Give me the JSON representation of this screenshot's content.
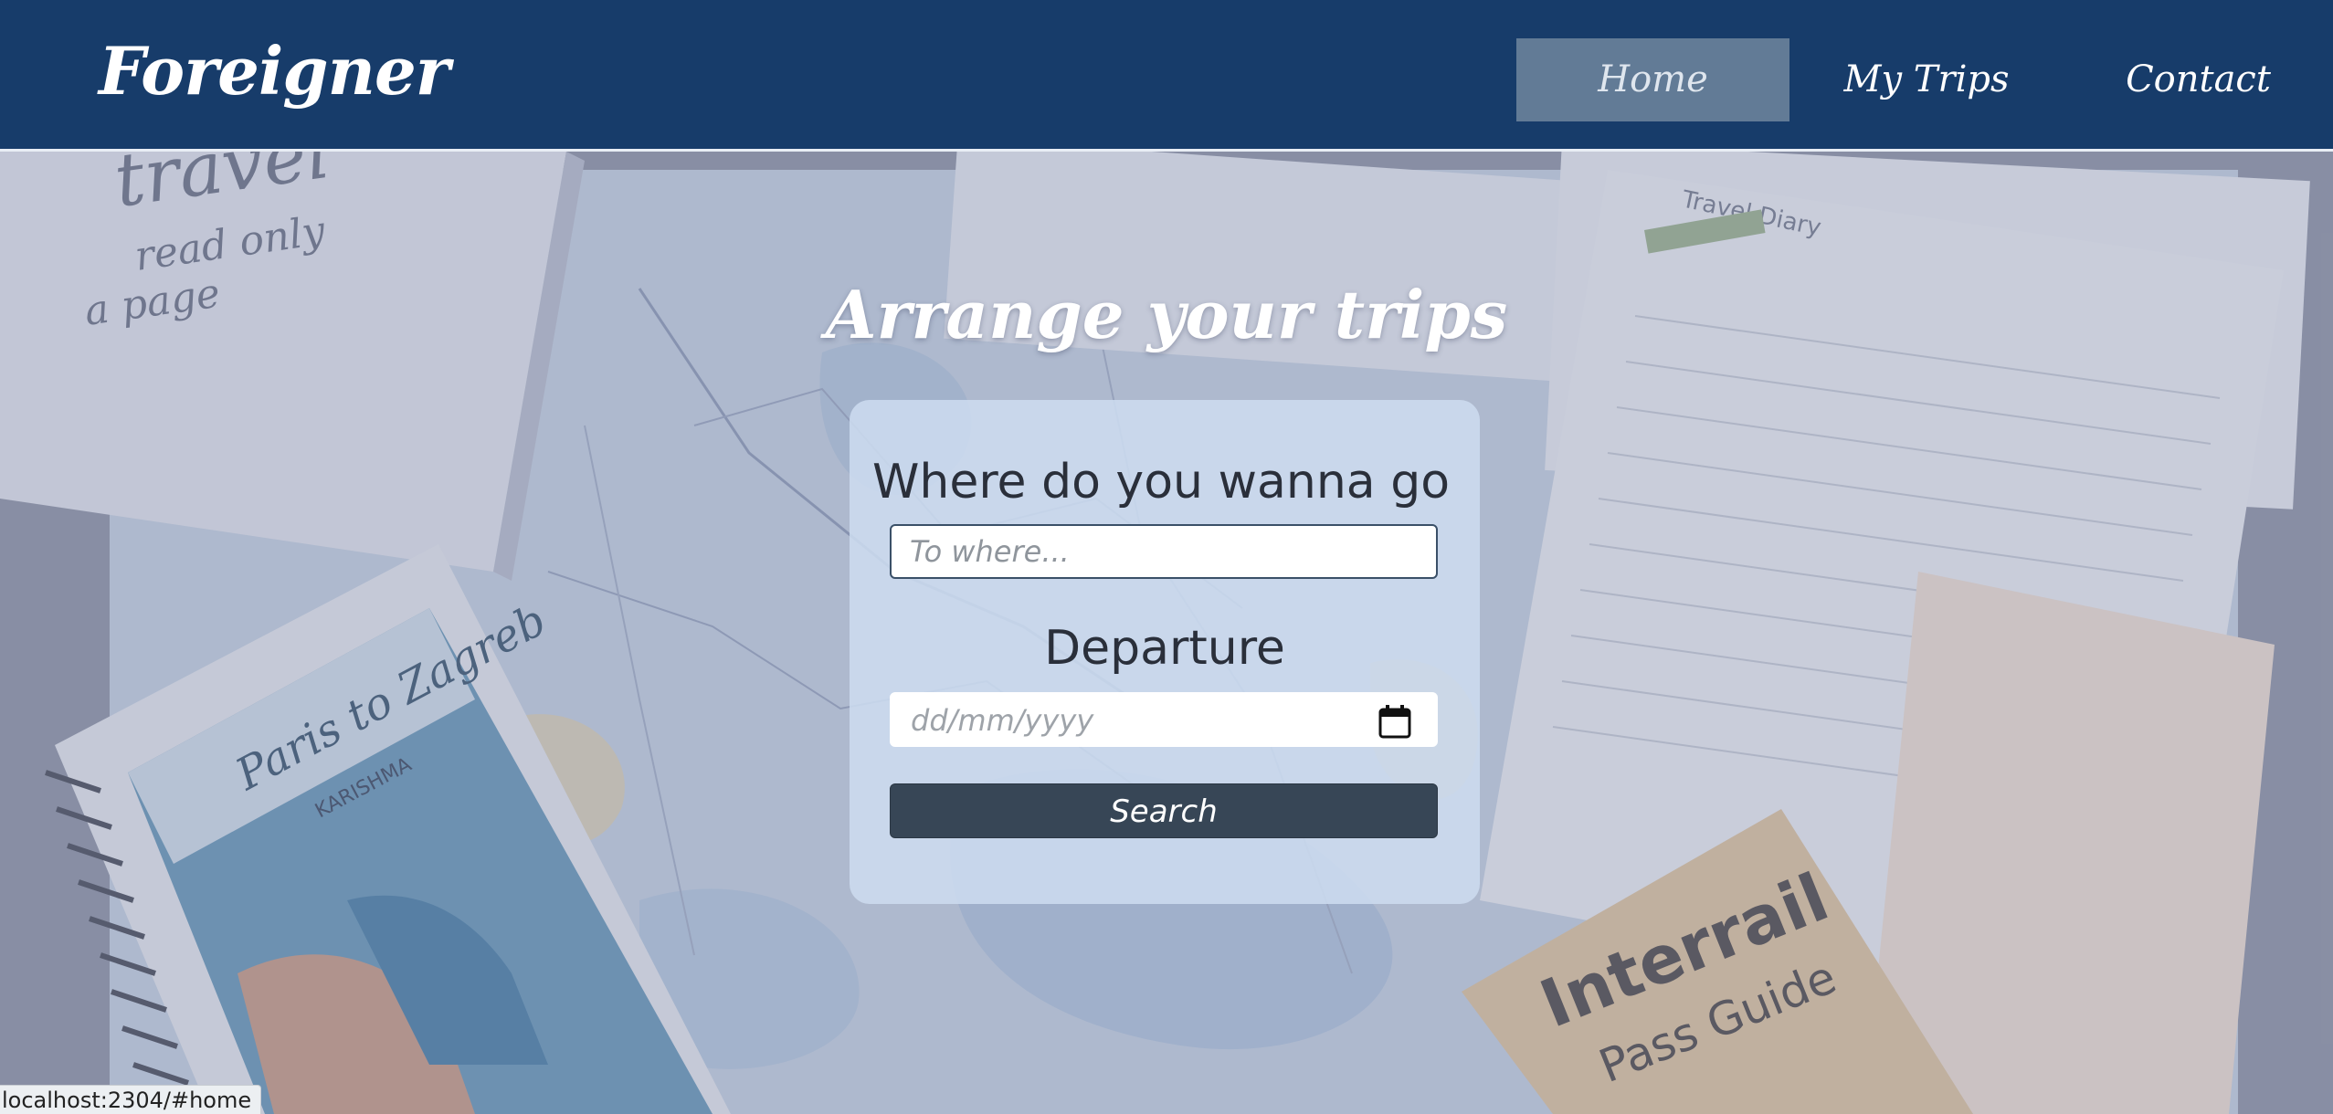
{
  "brand": {
    "name": "Foreigner"
  },
  "nav": {
    "items": [
      {
        "label": "Home",
        "active": true
      },
      {
        "label": "My Trips",
        "active": false
      },
      {
        "label": "Contact",
        "active": false
      }
    ]
  },
  "hero": {
    "title": "Arrange your trips"
  },
  "form": {
    "destination_label": "Where do you wanna go",
    "destination_placeholder": "To where...",
    "departure_label": "Departure",
    "departure_placeholder": "dd/mm/yyyy",
    "search_label": "Search"
  },
  "status_bar": {
    "url": "localhost:2304/#home"
  },
  "colors": {
    "navbar": "#173c6a",
    "nav_active": "#627b96",
    "card": "#cddcf0",
    "button": "#374656"
  },
  "icons": {
    "date_picker": "calendar-icon"
  },
  "background": {
    "description_text": [
      "travel",
      "read only",
      "a page",
      "Travel Diary",
      "Paris to Zagreb",
      "KARISHMA",
      "Interrail",
      "Pass Guide"
    ]
  }
}
